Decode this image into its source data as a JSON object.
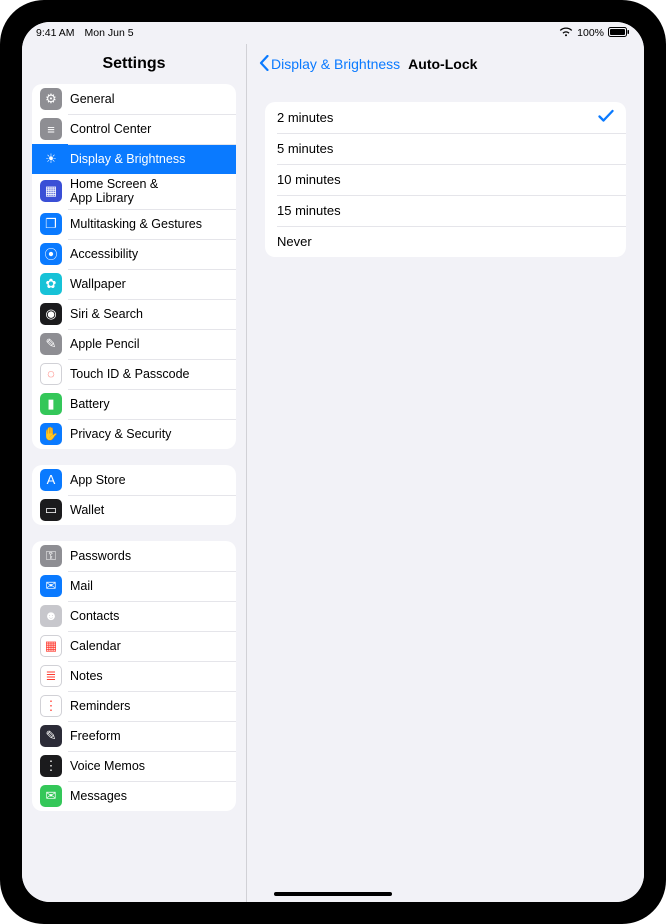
{
  "statusbar": {
    "time": "9:41 AM",
    "date": "Mon Jun 5",
    "battery_pct": "100%"
  },
  "sidebar": {
    "title": "Settings",
    "groups": [
      {
        "items": [
          {
            "id": "general",
            "label": "General",
            "icon": "gear",
            "bg": "#8e8e93"
          },
          {
            "id": "control-center",
            "label": "Control Center",
            "icon": "switches",
            "bg": "#8e8e93"
          },
          {
            "id": "display",
            "label": "Display & Brightness",
            "icon": "sun",
            "bg": "#0a7aff",
            "selected": true
          },
          {
            "id": "home-screen",
            "label": "Home Screen &\nApp Library",
            "icon": "grid",
            "bg": "#3a4fd6"
          },
          {
            "id": "multitasking",
            "label": "Multitasking & Gestures",
            "icon": "squares",
            "bg": "#0a7aff"
          },
          {
            "id": "accessibility",
            "label": "Accessibility",
            "icon": "person",
            "bg": "#0a7aff"
          },
          {
            "id": "wallpaper",
            "label": "Wallpaper",
            "icon": "flower",
            "bg": "#17c2d7"
          },
          {
            "id": "siri",
            "label": "Siri & Search",
            "icon": "siri",
            "bg": "#1b1b1d"
          },
          {
            "id": "apple-pencil",
            "label": "Apple Pencil",
            "icon": "pencil",
            "bg": "#8e8e93"
          },
          {
            "id": "touchid",
            "label": "Touch ID & Passcode",
            "icon": "fingerprint",
            "bg": "#ffffff"
          },
          {
            "id": "battery",
            "label": "Battery",
            "icon": "battery",
            "bg": "#34c759"
          },
          {
            "id": "privacy",
            "label": "Privacy & Security",
            "icon": "hand",
            "bg": "#0a7aff"
          }
        ]
      },
      {
        "items": [
          {
            "id": "app-store",
            "label": "App Store",
            "icon": "appstore",
            "bg": "#0a7aff"
          },
          {
            "id": "wallet",
            "label": "Wallet",
            "icon": "wallet",
            "bg": "#1b1b1d"
          }
        ]
      },
      {
        "items": [
          {
            "id": "passwords",
            "label": "Passwords",
            "icon": "key",
            "bg": "#8e8e93"
          },
          {
            "id": "mail",
            "label": "Mail",
            "icon": "envelope",
            "bg": "#0a7aff"
          },
          {
            "id": "contacts",
            "label": "Contacts",
            "icon": "contacts",
            "bg": "#c7c7cc"
          },
          {
            "id": "calendar",
            "label": "Calendar",
            "icon": "calendar",
            "bg": "#ffffff"
          },
          {
            "id": "notes",
            "label": "Notes",
            "icon": "notes",
            "bg": "#ffffff"
          },
          {
            "id": "reminders",
            "label": "Reminders",
            "icon": "reminders",
            "bg": "#ffffff"
          },
          {
            "id": "freeform",
            "label": "Freeform",
            "icon": "freeform",
            "bg": "#2b2b37"
          },
          {
            "id": "voicememos",
            "label": "Voice Memos",
            "icon": "voice",
            "bg": "#1b1b1d"
          },
          {
            "id": "messages",
            "label": "Messages",
            "icon": "messages",
            "bg": "#34c759"
          }
        ]
      }
    ]
  },
  "detail": {
    "back_label": "Display & Brightness",
    "title": "Auto-Lock",
    "options": [
      {
        "label": "2 minutes",
        "selected": true
      },
      {
        "label": "5 minutes",
        "selected": false
      },
      {
        "label": "10 minutes",
        "selected": false
      },
      {
        "label": "15 minutes",
        "selected": false
      },
      {
        "label": "Never",
        "selected": false
      }
    ]
  },
  "icons": {
    "gear": "⚙︎",
    "switches": "≡",
    "sun": "☀",
    "grid": "▦",
    "squares": "❐",
    "person": "⦿",
    "flower": "✿",
    "siri": "◉",
    "pencil": "✎",
    "fingerprint": "◌",
    "battery": "▮",
    "hand": "✋",
    "appstore": "A",
    "wallet": "▭",
    "key": "⚿",
    "envelope": "✉",
    "contacts": "☻",
    "calendar": "▦",
    "notes": "≣",
    "reminders": "⋮",
    "freeform": "✎",
    "voice": "⋮",
    "messages": "✉"
  }
}
